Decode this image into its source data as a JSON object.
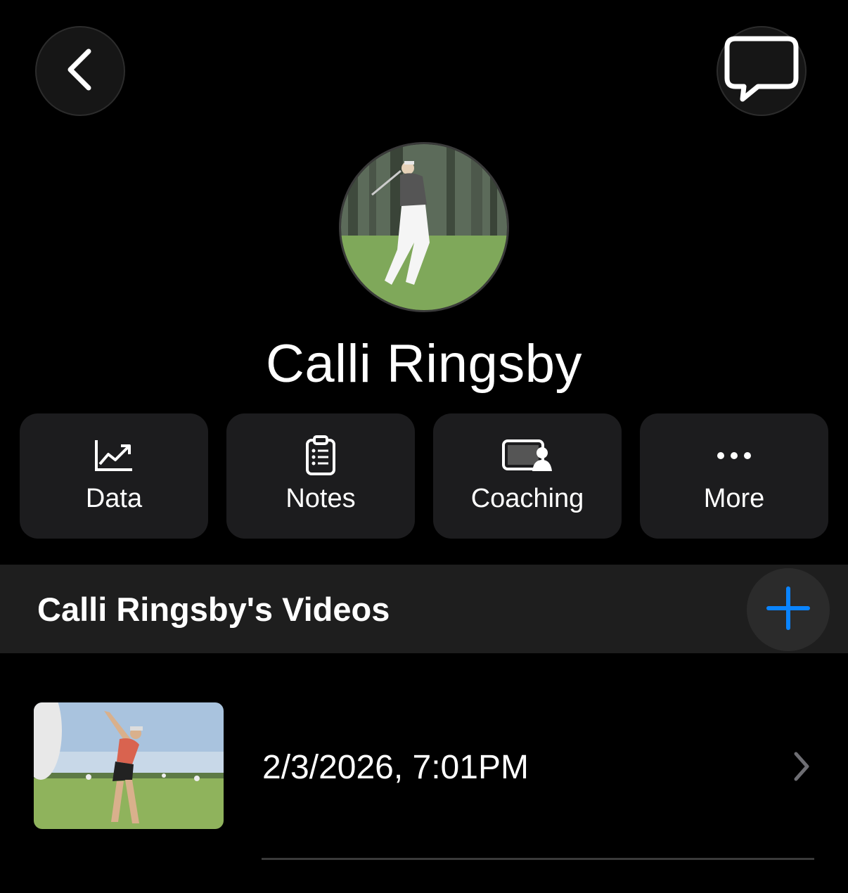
{
  "header": {
    "back_icon": "chevron-left-icon",
    "chat_icon": "chat-bubble-icon"
  },
  "profile": {
    "name": "Calli Ringsby",
    "avatar_description": "golfer-photo"
  },
  "actions": [
    {
      "label": "Data",
      "icon": "chart-trend-icon"
    },
    {
      "label": "Notes",
      "icon": "clipboard-list-icon"
    },
    {
      "label": "Coaching",
      "icon": "video-coaching-icon"
    },
    {
      "label": "More",
      "icon": "ellipsis-icon"
    }
  ],
  "videos": {
    "title": "Calli Ringsby's Videos",
    "add_icon": "plus-icon",
    "items": [
      {
        "date": "2/3/2026, 7:01PM"
      }
    ]
  },
  "colors": {
    "accent": "#0a84ff",
    "tile_bg": "#1c1c1e",
    "header_bg": "#1e1e1e"
  }
}
